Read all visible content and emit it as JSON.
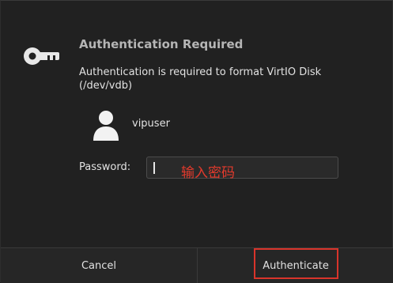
{
  "dialog": {
    "title": "Authentication Required",
    "message": "Authentication is required to format VirtIO Disk (/dev/vdb)",
    "icon": "key-icon"
  },
  "user": {
    "icon": "user-icon",
    "name": "vipuser"
  },
  "password": {
    "label": "Password:",
    "value": ""
  },
  "annotation": {
    "text": "输入密码",
    "color": "#e23a2c"
  },
  "buttons": {
    "cancel_label": "Cancel",
    "authenticate_label": "Authenticate"
  },
  "colors": {
    "background": "#212121",
    "highlight": "#d9342b"
  }
}
